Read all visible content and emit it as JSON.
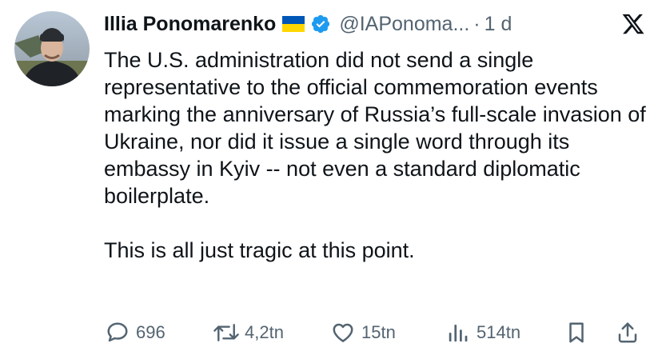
{
  "tweet": {
    "author_name": "Illia Ponomarenko",
    "handle": "@IAPonoma...",
    "separator": "·",
    "time": "1 d",
    "paragraphs": [
      "The U.S. administration did not send a single representative to the official commemoration events marking the anniversary of Russia’s full-scale invasion of Ukraine, nor did it issue a single word through its embassy in Kyiv -- not even a standard diplomatic boilerplate.",
      "This is all just tragic at this point."
    ]
  },
  "actions": {
    "replies": "696",
    "reposts": "4,2tn",
    "likes": "15tn",
    "views": "514tn"
  },
  "icons": {
    "flag": "ukraine-flag-icon",
    "verified": "verified-badge-icon",
    "platform": "x-logo-icon",
    "reply": "reply-icon",
    "repost": "repost-icon",
    "like": "like-icon",
    "views": "views-icon",
    "bookmark": "bookmark-icon",
    "share": "share-icon"
  },
  "colors": {
    "text": "#0f1419",
    "secondary": "#536471",
    "verified_blue": "#1d9bf0",
    "flag_blue": "#0057b7",
    "flag_yellow": "#ffd700"
  }
}
